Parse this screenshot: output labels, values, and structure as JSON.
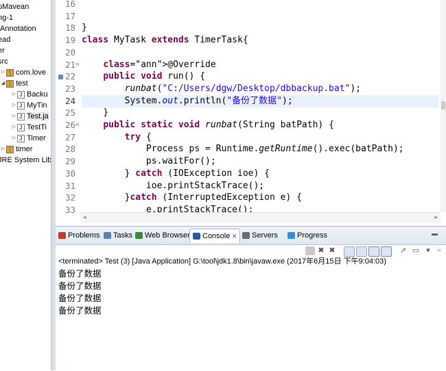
{
  "explorer": {
    "items": [
      {
        "label": "pMavean",
        "icon": "none",
        "indent": 0
      },
      {
        "label": "ng-1",
        "icon": "none",
        "indent": 0
      },
      {
        "label": "tAnnotation",
        "icon": "none",
        "indent": 0
      },
      {
        "label": "ead",
        "icon": "none",
        "indent": 0
      },
      {
        "label": "er",
        "icon": "none",
        "indent": 0
      },
      {
        "label": "src",
        "icon": "none",
        "indent": 0
      },
      {
        "label": "com.love",
        "icon": "package-icon",
        "indent": 1
      },
      {
        "label": "test",
        "icon": "package-icon",
        "indent": 1
      },
      {
        "label": "Backu",
        "icon": "java-file-icon",
        "indent": 2
      },
      {
        "label": "MyTin",
        "icon": "java-file-icon",
        "indent": 2
      },
      {
        "label": "Test.ja",
        "icon": "java-file-icon",
        "indent": 2
      },
      {
        "label": "TestTi",
        "icon": "java-file-icon",
        "indent": 2
      },
      {
        "label": "Timer",
        "icon": "java-file-icon",
        "indent": 2
      },
      {
        "label": "timer",
        "icon": "package-icon",
        "indent": 1
      },
      {
        "label": "JRE System Libr",
        "icon": "none",
        "indent": 0
      }
    ]
  },
  "editor": {
    "lines": [
      {
        "num": "16",
        "code": ""
      },
      {
        "num": "17",
        "code": ""
      },
      {
        "num": "18",
        "code": "}"
      },
      {
        "num": "19",
        "code": "class MyTask extends TimerTask{"
      },
      {
        "num": "20",
        "code": ""
      },
      {
        "num": "21",
        "code": "    @Override"
      },
      {
        "num": "22",
        "code": "    public void run() {"
      },
      {
        "num": "23",
        "code": "        runbat(\"C:/Users/dgw/Desktop/dbbackup.bat\");"
      },
      {
        "num": "24",
        "code": "        System.out.println(\"备份了数据\");"
      },
      {
        "num": "25",
        "code": "    }"
      },
      {
        "num": "26",
        "code": "    public static void runbat(String batPath) {"
      },
      {
        "num": "27",
        "code": "        try {"
      },
      {
        "num": "28",
        "code": "            Process ps = Runtime.getRuntime().exec(batPath);"
      },
      {
        "num": "29",
        "code": "            ps.waitFor();"
      },
      {
        "num": "30",
        "code": "        } catch (IOException ioe) {"
      },
      {
        "num": "31",
        "code": "            ioe.printStackTrace();"
      },
      {
        "num": "32",
        "code": "        }catch (InterruptedException e) {"
      },
      {
        "num": "33",
        "code": "            e.printStackTrace();"
      }
    ],
    "current_line": "24"
  },
  "panel": {
    "tabs": [
      {
        "label": "Problems",
        "icon": "problems-icon",
        "color": "#c0392b"
      },
      {
        "label": "Tasks",
        "icon": "tasks-icon",
        "color": "#5a7fb0"
      },
      {
        "label": "Web Browser",
        "icon": "globe-icon",
        "color": "#3a8a3a"
      },
      {
        "label": "Console",
        "icon": "console-icon",
        "color": "#2a5aa0"
      },
      {
        "label": "Servers",
        "icon": "servers-icon",
        "color": "#6a6a6a"
      },
      {
        "label": "Progress",
        "icon": "progress-icon",
        "color": "#2f8fd8"
      }
    ],
    "active_tab": "Console",
    "close_glyph": "✕",
    "status": "<terminated> Test (3) [Java Application] G:\\tool\\jdk1.8\\bin\\javaw.exe (2017年6月15日 下午9:04:03)",
    "output": [
      "备份了数据",
      "备份了数据",
      "备份了数据",
      "备份了数据"
    ]
  },
  "colors": {
    "keyword": "#7f0055",
    "string": "#2a00ff",
    "annotation": "#646464",
    "current_line_bg": "#e8f2fe"
  }
}
